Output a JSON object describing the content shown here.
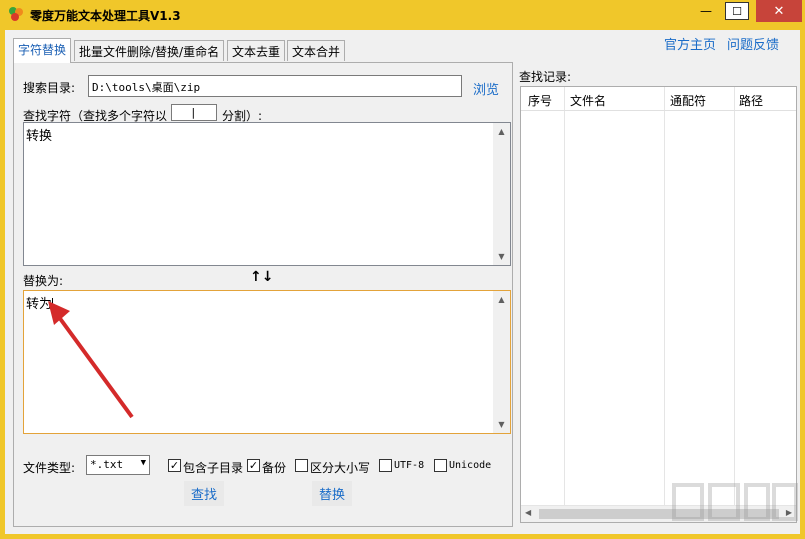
{
  "window": {
    "title": "零度万能文本处理工具V1.3",
    "minimize_glyph": "—",
    "maximize_glyph": "☐",
    "close_glyph": "✕"
  },
  "tabs": [
    {
      "label": "字符替换",
      "active": true
    },
    {
      "label": "批量文件删除/替换/重命名",
      "active": false
    },
    {
      "label": "文本去重",
      "active": false
    },
    {
      "label": "文本合并",
      "active": false
    }
  ],
  "top_links": {
    "home": "官方主页",
    "feedback": "问题反馈"
  },
  "search_dir": {
    "label": "搜索目录:",
    "value": "D:\\tools\\桌面\\zip",
    "browse": "浏览"
  },
  "find": {
    "label_before": "查找字符（查找多个字符以",
    "separator_value": "|",
    "label_after": "分割）:",
    "text": "转换"
  },
  "replace": {
    "label": "替换为:",
    "swap_label": "↑↓",
    "text": "转为"
  },
  "options": {
    "file_type_label": "文件类型:",
    "file_type_value": "*.txt",
    "include_subdirs": {
      "label": "包含子目录",
      "checked": true
    },
    "backup": {
      "label": "备份",
      "checked": true
    },
    "case_sensitive": {
      "label": "区分大小写",
      "checked": false
    },
    "utf8": {
      "label": "UTF-8",
      "checked": false
    },
    "unicode": {
      "label": "Unicode",
      "checked": false
    }
  },
  "actions": {
    "find": "查找",
    "replace": "替换"
  },
  "results": {
    "label": "查找记录:",
    "columns": [
      "序号",
      "文件名",
      "通配符",
      "路径"
    ]
  },
  "colors": {
    "title_bar": "#f0c72a",
    "accent_link": "#1a6cc8",
    "close_button": "#c7443a",
    "annotation_arrow": "#d42a2a"
  }
}
